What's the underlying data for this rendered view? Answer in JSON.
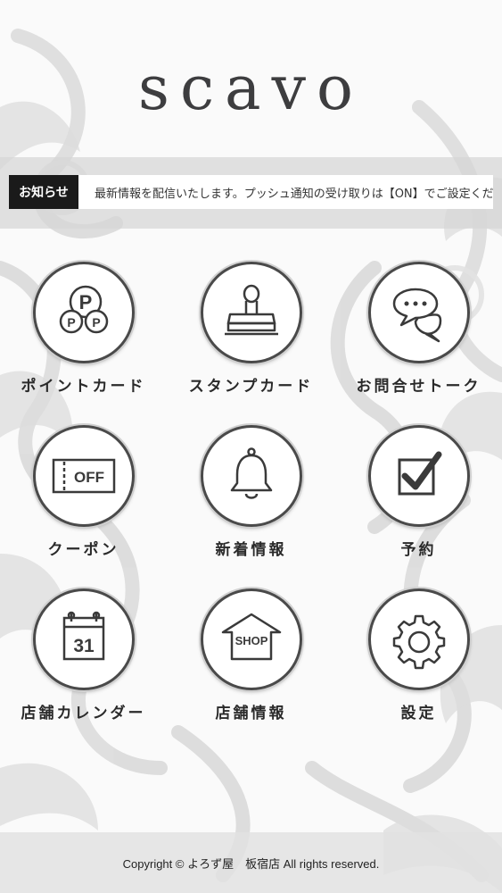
{
  "header": {
    "logo_text": "scavo"
  },
  "notice": {
    "label": "お知らせ",
    "text": "最新情報を配信いたします。プッシュ通知の受け取りは【ON】でご設定ください。"
  },
  "menu": {
    "items": [
      {
        "label": "ポイントカード",
        "icon": "point-card-icon"
      },
      {
        "label": "スタンプカード",
        "icon": "stamp-icon"
      },
      {
        "label": "お問合せトーク",
        "icon": "chat-icon"
      },
      {
        "label": "クーポン",
        "icon": "coupon-icon"
      },
      {
        "label": "新着情報",
        "icon": "bell-icon"
      },
      {
        "label": "予約",
        "icon": "checkbox-icon"
      },
      {
        "label": "店舗カレンダー",
        "icon": "calendar-icon"
      },
      {
        "label": "店舗情報",
        "icon": "shop-icon"
      },
      {
        "label": "設定",
        "icon": "gear-icon"
      }
    ],
    "coupon_icon_text": "OFF",
    "calendar_icon_text": "31",
    "shop_icon_text": "SHOP"
  },
  "footer": {
    "copyright": "Copyright © よろず屋　板宿店 All rights reserved."
  },
  "colors": {
    "icon_stroke": "#3a3a3a",
    "notice_label_bg": "#1a1a1a",
    "background": "#fafafa"
  }
}
